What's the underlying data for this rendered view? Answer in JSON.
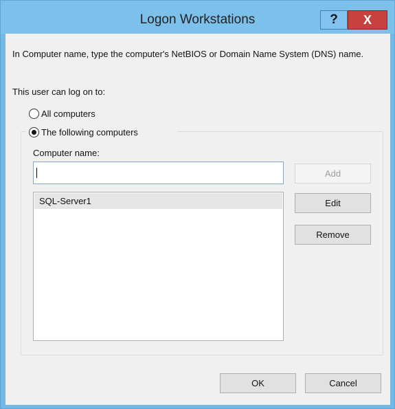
{
  "window": {
    "title": "Logon Workstations",
    "help_label": "?",
    "close_label": "X"
  },
  "description": "In Computer name, type the computer's NetBIOS or Domain Name System (DNS) name.",
  "logon_label": "This user can log on to:",
  "options": {
    "all_computers": "All computers",
    "following_computers": "The following computers",
    "selected": "following_computers"
  },
  "computer_name": {
    "label": "Computer name:",
    "value": ""
  },
  "computers": [
    "SQL-Server1"
  ],
  "buttons": {
    "add": "Add",
    "edit": "Edit",
    "remove": "Remove",
    "ok": "OK",
    "cancel": "Cancel"
  }
}
